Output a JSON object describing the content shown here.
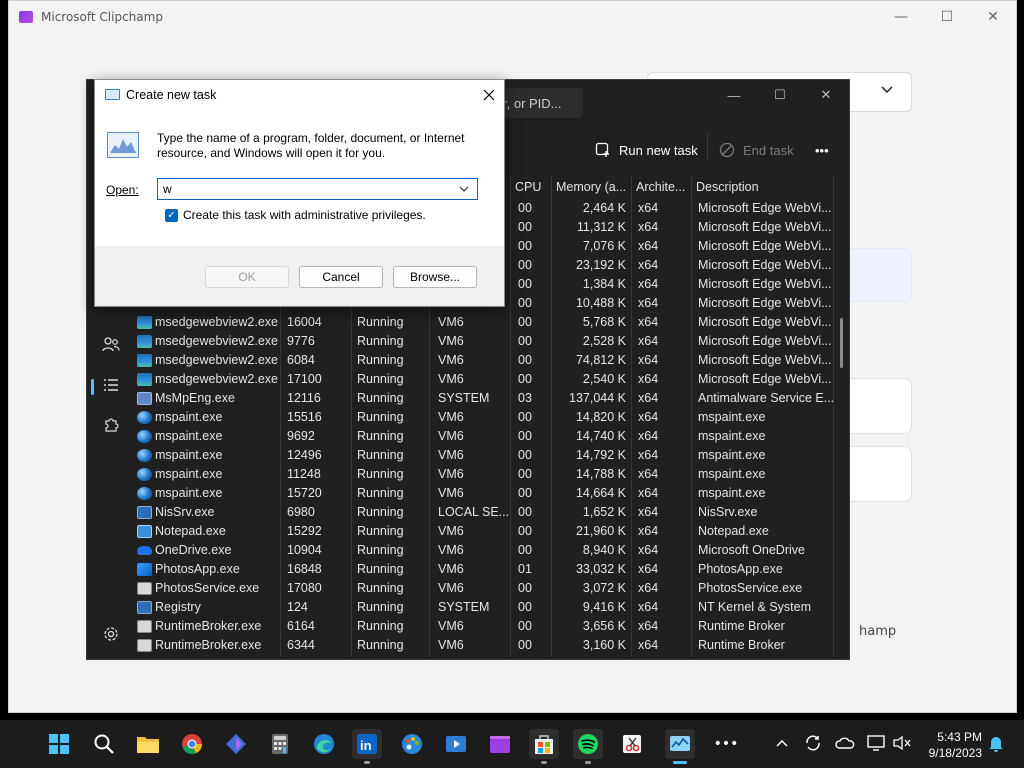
{
  "clipchamp": {
    "title": "Microsoft Clipchamp",
    "bottom_fragment": "hamp",
    "controls": {
      "minimize": "—",
      "maximize": "☐",
      "close": "✕"
    }
  },
  "taskmgr": {
    "search_placeholder": "r, or PID...",
    "toolbar": {
      "run_new_task": "Run new task",
      "end_task": "End task",
      "more": "•••"
    },
    "columns": [
      "CPU",
      "Memory (a...",
      "Archite...",
      "Description"
    ],
    "rows": [
      {
        "icon": "none",
        "name": "",
        "pid": "",
        "status": "",
        "user": "",
        "cpu": "00",
        "mem": "2,464 K",
        "arch": "x64",
        "desc": "Microsoft Edge WebVi..."
      },
      {
        "icon": "none",
        "name": "",
        "pid": "",
        "status": "",
        "user": "",
        "cpu": "00",
        "mem": "11,312 K",
        "arch": "x64",
        "desc": "Microsoft Edge WebVi..."
      },
      {
        "icon": "none",
        "name": "",
        "pid": "",
        "status": "",
        "user": "",
        "cpu": "00",
        "mem": "7,076 K",
        "arch": "x64",
        "desc": "Microsoft Edge WebVi..."
      },
      {
        "icon": "none",
        "name": "",
        "pid": "",
        "status": "",
        "user": "",
        "cpu": "00",
        "mem": "23,192 K",
        "arch": "x64",
        "desc": "Microsoft Edge WebVi..."
      },
      {
        "icon": "none",
        "name": "",
        "pid": "",
        "status": "",
        "user": "",
        "cpu": "00",
        "mem": "1,384 K",
        "arch": "x64",
        "desc": "Microsoft Edge WebVi..."
      },
      {
        "icon": "none",
        "name": "",
        "pid": "",
        "status": "",
        "user": "",
        "cpu": "00",
        "mem": "10,488 K",
        "arch": "x64",
        "desc": "Microsoft Edge WebVi..."
      },
      {
        "icon": "edge",
        "name": "msedgewebview2.exe",
        "pid": "16004",
        "status": "Running",
        "user": "VM6",
        "cpu": "00",
        "mem": "5,768 K",
        "arch": "x64",
        "desc": "Microsoft Edge WebVi..."
      },
      {
        "icon": "edge",
        "name": "msedgewebview2.exe",
        "pid": "9776",
        "status": "Running",
        "user": "VM6",
        "cpu": "00",
        "mem": "2,528 K",
        "arch": "x64",
        "desc": "Microsoft Edge WebVi..."
      },
      {
        "icon": "edge",
        "name": "msedgewebview2.exe",
        "pid": "6084",
        "status": "Running",
        "user": "VM6",
        "cpu": "00",
        "mem": "74,812 K",
        "arch": "x64",
        "desc": "Microsoft Edge WebVi..."
      },
      {
        "icon": "edge",
        "name": "msedgewebview2.exe",
        "pid": "17100",
        "status": "Running",
        "user": "VM6",
        "cpu": "00",
        "mem": "2,540 K",
        "arch": "x64",
        "desc": "Microsoft Edge WebVi..."
      },
      {
        "icon": "defender",
        "name": "MsMpEng.exe",
        "pid": "12116",
        "status": "Running",
        "user": "SYSTEM",
        "cpu": "03",
        "mem": "137,044 K",
        "arch": "x64",
        "desc": "Antimalware Service E..."
      },
      {
        "icon": "paint",
        "name": "mspaint.exe",
        "pid": "15516",
        "status": "Running",
        "user": "VM6",
        "cpu": "00",
        "mem": "14,820 K",
        "arch": "x64",
        "desc": "mspaint.exe"
      },
      {
        "icon": "paint",
        "name": "mspaint.exe",
        "pid": "9692",
        "status": "Running",
        "user": "VM6",
        "cpu": "00",
        "mem": "14,740 K",
        "arch": "x64",
        "desc": "mspaint.exe"
      },
      {
        "icon": "paint",
        "name": "mspaint.exe",
        "pid": "12496",
        "status": "Running",
        "user": "VM6",
        "cpu": "00",
        "mem": "14,792 K",
        "arch": "x64",
        "desc": "mspaint.exe"
      },
      {
        "icon": "paint",
        "name": "mspaint.exe",
        "pid": "11248",
        "status": "Running",
        "user": "VM6",
        "cpu": "00",
        "mem": "14,788 K",
        "arch": "x64",
        "desc": "mspaint.exe"
      },
      {
        "icon": "paint",
        "name": "mspaint.exe",
        "pid": "15720",
        "status": "Running",
        "user": "VM6",
        "cpu": "00",
        "mem": "14,664 K",
        "arch": "x64",
        "desc": "mspaint.exe"
      },
      {
        "icon": "nis",
        "name": "NisSrv.exe",
        "pid": "6980",
        "status": "Running",
        "user": "LOCAL SE...",
        "cpu": "00",
        "mem": "1,652 K",
        "arch": "x64",
        "desc": "NisSrv.exe"
      },
      {
        "icon": "note",
        "name": "Notepad.exe",
        "pid": "15292",
        "status": "Running",
        "user": "VM6",
        "cpu": "00",
        "mem": "21,960 K",
        "arch": "x64",
        "desc": "Notepad.exe"
      },
      {
        "icon": "onedrive",
        "name": "OneDrive.exe",
        "pid": "10904",
        "status": "Running",
        "user": "VM6",
        "cpu": "00",
        "mem": "8,940 K",
        "arch": "x64",
        "desc": "Microsoft OneDrive"
      },
      {
        "icon": "photos",
        "name": "PhotosApp.exe",
        "pid": "16848",
        "status": "Running",
        "user": "VM6",
        "cpu": "01",
        "mem": "33,032 K",
        "arch": "x64",
        "desc": "PhotosApp.exe"
      },
      {
        "icon": "service",
        "name": "PhotosService.exe",
        "pid": "17080",
        "status": "Running",
        "user": "VM6",
        "cpu": "00",
        "mem": "3,072 K",
        "arch": "x64",
        "desc": "PhotosService.exe"
      },
      {
        "icon": "registry",
        "name": "Registry",
        "pid": "124",
        "status": "Running",
        "user": "SYSTEM",
        "cpu": "00",
        "mem": "9,416 K",
        "arch": "x64",
        "desc": "NT Kernel & System"
      },
      {
        "icon": "service",
        "name": "RuntimeBroker.exe",
        "pid": "6164",
        "status": "Running",
        "user": "VM6",
        "cpu": "00",
        "mem": "3,656 K",
        "arch": "x64",
        "desc": "Runtime Broker"
      },
      {
        "icon": "service",
        "name": "RuntimeBroker.exe",
        "pid": "6344",
        "status": "Running",
        "user": "VM6",
        "cpu": "00",
        "mem": "3,160 K",
        "arch": "x64",
        "desc": "Runtime Broker"
      }
    ]
  },
  "run_dialog": {
    "title": "Create new task",
    "description": "Type the name of a program, folder, document, or Internet resource, and Windows will open it for you.",
    "open_label": "Open:",
    "input_value": "w",
    "checkbox_label": "Create this task with administrative privileges.",
    "checkbox_checked": true,
    "ok_label": "OK",
    "cancel_label": "Cancel",
    "browse_label": "Browse..."
  },
  "taskbar": {
    "time": "5:43 PM",
    "date": "9/18/2023",
    "apps": [
      "start-icon",
      "search-icon",
      "file-explorer-icon",
      "chrome-icon",
      "copilot-icon",
      "calculator-icon",
      "edge-icon",
      "linkedin-icon",
      "paint-icon",
      "video-player-icon",
      "clipchamp-icon",
      "store-icon",
      "spotify-icon",
      "snipping-tool-icon",
      "task-manager-icon",
      "more-icon"
    ]
  }
}
